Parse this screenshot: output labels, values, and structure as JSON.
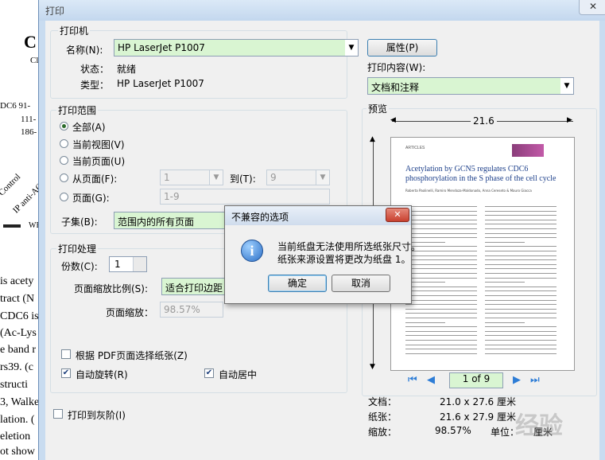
{
  "background_doc": {
    "letter_c": "C",
    "frag_cl": "Cl",
    "rows": [
      "DC6  91-",
      "111-",
      "186-"
    ],
    "control": "Control",
    "ip_anti": "IP anti-AC",
    "wb": "WB",
    "text_lines": [
      "is acety",
      "tract (N",
      "CDC6 is",
      "(Ac-Lys",
      "e band r",
      "rs39. (c",
      "structi",
      "3, Walke",
      "lation. (",
      "eletion",
      "ot show"
    ]
  },
  "dialog": {
    "title": "打印",
    "close": "✕",
    "printer": {
      "group": "打印机",
      "name_label": "名称(N):",
      "name_value": "HP LaserJet P1007",
      "status_label": "状态：",
      "status_value": "就绪",
      "type_label": "类型：",
      "type_value": "HP LaserJet P1007",
      "properties_button": "属性(P)",
      "content_label": "打印内容(W):",
      "content_value": "文档和注释"
    },
    "range": {
      "group": "打印范围",
      "all": "全部(A)",
      "current_view": "当前视图(V)",
      "current_page": "当前页面(U)",
      "from_page": "从页面(F):",
      "from_value": "1",
      "to_label": "到(T):",
      "to_value": "9",
      "pages": "页面(G):",
      "pages_value": "1-9",
      "subset_label": "子集(B):",
      "subset_value": "范围内的所有页面"
    },
    "handling": {
      "group": "打印处理",
      "copies_label": "份数(C):",
      "copies_value": "1",
      "scaling_label": "页面缩放比例(S):",
      "scaling_value": "适合打印边距",
      "zoom_label": "页面缩放：",
      "zoom_value": "98.57%",
      "pdf_paper": "根据 PDF页面选择纸张(Z)",
      "auto_rotate": "自动旋转(R)",
      "auto_center": "自动居中"
    },
    "grayscale": "打印到灰阶(I)",
    "preview": {
      "label": "预览",
      "width": "21.6",
      "page_indicator": "1 of 9",
      "doc_label": "文档：",
      "doc_value": "21.0 x 27.6 厘米",
      "paper_label": "纸张：",
      "paper_value": "21.6 x 27.9 厘米",
      "zoom_label": "缩放：",
      "zoom_value": "98.57%",
      "unit_label": "单位：",
      "unit_value": "厘米"
    },
    "page_thumb": {
      "header_left": "ARTICLES",
      "title": "Acetylation by GCN5 regulates CDC6 phosphorylation in the S phase of the cell cycle",
      "authors": "Roberta Paolinelli, Ramiro Mendoza-Maldonado, Anna Cereseto & Mauro Giacca"
    }
  },
  "alert": {
    "title": "不兼容的选项",
    "close": "✕",
    "line1": "当前纸盘无法使用所选纸张尺寸。",
    "line2": "纸张来源设置将更改为纸盘 1。",
    "ok": "确定",
    "cancel": "取消"
  },
  "watermark": "经验",
  "colors": {
    "highlight": "#d9f5d2",
    "accent": "#2e7dd6",
    "close_red": "#c8402f"
  }
}
